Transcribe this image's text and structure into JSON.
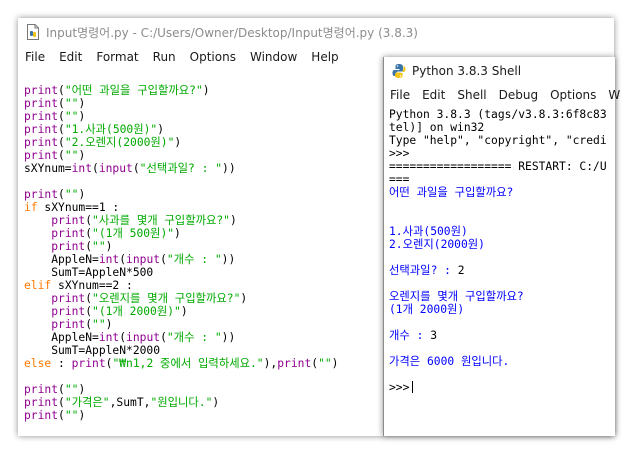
{
  "editor": {
    "title": "Input명령어.py - C:/Users/Owner/Desktop/Input명령어.py (3.8.3)",
    "menu": [
      "File",
      "Edit",
      "Format",
      "Run",
      "Options",
      "Window",
      "Help"
    ],
    "code": [
      [
        {
          "t": "print",
          "c": "bi"
        },
        {
          "t": "(",
          "c": "df"
        },
        {
          "t": "\"어떤 과일을 구입할까요?\"",
          "c": "st"
        },
        {
          "t": ")",
          "c": "df"
        }
      ],
      [
        {
          "t": "print",
          "c": "bi"
        },
        {
          "t": "(",
          "c": "df"
        },
        {
          "t": "\"\"",
          "c": "st"
        },
        {
          "t": ")",
          "c": "df"
        }
      ],
      [
        {
          "t": "print",
          "c": "bi"
        },
        {
          "t": "(",
          "c": "df"
        },
        {
          "t": "\"\"",
          "c": "st"
        },
        {
          "t": ")",
          "c": "df"
        }
      ],
      [
        {
          "t": "print",
          "c": "bi"
        },
        {
          "t": "(",
          "c": "df"
        },
        {
          "t": "\"1.사과(500원)\"",
          "c": "st"
        },
        {
          "t": ")",
          "c": "df"
        }
      ],
      [
        {
          "t": "print",
          "c": "bi"
        },
        {
          "t": "(",
          "c": "df"
        },
        {
          "t": "\"2.오렌지(2000원)\"",
          "c": "st"
        },
        {
          "t": ")",
          "c": "df"
        }
      ],
      [
        {
          "t": "print",
          "c": "bi"
        },
        {
          "t": "(",
          "c": "df"
        },
        {
          "t": "\"\"",
          "c": "st"
        },
        {
          "t": ")",
          "c": "df"
        }
      ],
      [
        {
          "t": "sXYnum=",
          "c": "df"
        },
        {
          "t": "int",
          "c": "bi"
        },
        {
          "t": "(",
          "c": "df"
        },
        {
          "t": "input",
          "c": "bi"
        },
        {
          "t": "(",
          "c": "df"
        },
        {
          "t": "\"선택과일? : \"",
          "c": "st"
        },
        {
          "t": "))",
          "c": "df"
        }
      ],
      [],
      [
        {
          "t": "print",
          "c": "bi"
        },
        {
          "t": "(",
          "c": "df"
        },
        {
          "t": "\"\"",
          "c": "st"
        },
        {
          "t": ")",
          "c": "df"
        }
      ],
      [
        {
          "t": "if",
          "c": "kw"
        },
        {
          "t": " sXYnum==1 :",
          "c": "df"
        }
      ],
      [
        {
          "t": "    ",
          "c": "df"
        },
        {
          "t": "print",
          "c": "bi"
        },
        {
          "t": "(",
          "c": "df"
        },
        {
          "t": "\"사과를 몇개 구입할까요?\"",
          "c": "st"
        },
        {
          "t": ")",
          "c": "df"
        }
      ],
      [
        {
          "t": "    ",
          "c": "df"
        },
        {
          "t": "print",
          "c": "bi"
        },
        {
          "t": "(",
          "c": "df"
        },
        {
          "t": "\"(1개 500원)\"",
          "c": "st"
        },
        {
          "t": ")",
          "c": "df"
        }
      ],
      [
        {
          "t": "    ",
          "c": "df"
        },
        {
          "t": "print",
          "c": "bi"
        },
        {
          "t": "(",
          "c": "df"
        },
        {
          "t": "\"\"",
          "c": "st"
        },
        {
          "t": ")",
          "c": "df"
        }
      ],
      [
        {
          "t": "    AppleN=",
          "c": "df"
        },
        {
          "t": "int",
          "c": "bi"
        },
        {
          "t": "(",
          "c": "df"
        },
        {
          "t": "input",
          "c": "bi"
        },
        {
          "t": "(",
          "c": "df"
        },
        {
          "t": "\"개수 : \"",
          "c": "st"
        },
        {
          "t": "))",
          "c": "df"
        }
      ],
      [
        {
          "t": "    SumT=AppleN*500",
          "c": "df"
        }
      ],
      [
        {
          "t": "elif",
          "c": "kw"
        },
        {
          "t": " sXYnum==2 :",
          "c": "df"
        }
      ],
      [
        {
          "t": "    ",
          "c": "df"
        },
        {
          "t": "print",
          "c": "bi"
        },
        {
          "t": "(",
          "c": "df"
        },
        {
          "t": "\"오렌지를 몇개 구입할까요?\"",
          "c": "st"
        },
        {
          "t": ")",
          "c": "df"
        }
      ],
      [
        {
          "t": "    ",
          "c": "df"
        },
        {
          "t": "print",
          "c": "bi"
        },
        {
          "t": "(",
          "c": "df"
        },
        {
          "t": "\"(1개 2000원)\"",
          "c": "st"
        },
        {
          "t": ")",
          "c": "df"
        }
      ],
      [
        {
          "t": "    ",
          "c": "df"
        },
        {
          "t": "print",
          "c": "bi"
        },
        {
          "t": "(",
          "c": "df"
        },
        {
          "t": "\"\"",
          "c": "st"
        },
        {
          "t": ")",
          "c": "df"
        }
      ],
      [
        {
          "t": "    AppleN=",
          "c": "df"
        },
        {
          "t": "int",
          "c": "bi"
        },
        {
          "t": "(",
          "c": "df"
        },
        {
          "t": "input",
          "c": "bi"
        },
        {
          "t": "(",
          "c": "df"
        },
        {
          "t": "\"개수 : \"",
          "c": "st"
        },
        {
          "t": "))",
          "c": "df"
        }
      ],
      [
        {
          "t": "    SumT=AppleN*2000",
          "c": "df"
        }
      ],
      [
        {
          "t": "else",
          "c": "kw"
        },
        {
          "t": " : ",
          "c": "df"
        },
        {
          "t": "print",
          "c": "bi"
        },
        {
          "t": "(",
          "c": "df"
        },
        {
          "t": "\"₩n1,2 중에서 입력하세요.\"",
          "c": "st"
        },
        {
          "t": "),",
          "c": "df"
        },
        {
          "t": "print",
          "c": "bi"
        },
        {
          "t": "(",
          "c": "df"
        },
        {
          "t": "\"\"",
          "c": "st"
        },
        {
          "t": ")",
          "c": "df"
        }
      ],
      [],
      [
        {
          "t": "print",
          "c": "bi"
        },
        {
          "t": "(",
          "c": "df"
        },
        {
          "t": "\"\"",
          "c": "st"
        },
        {
          "t": ")",
          "c": "df"
        }
      ],
      [
        {
          "t": "print",
          "c": "bi"
        },
        {
          "t": "(",
          "c": "df"
        },
        {
          "t": "\"가격은\"",
          "c": "st"
        },
        {
          "t": ",SumT,",
          "c": "df"
        },
        {
          "t": "\"원입니다.\"",
          "c": "st"
        },
        {
          "t": ")",
          "c": "df"
        }
      ],
      [
        {
          "t": "print",
          "c": "bi"
        },
        {
          "t": "(",
          "c": "df"
        },
        {
          "t": "\"\"",
          "c": "st"
        },
        {
          "t": ")",
          "c": "df"
        }
      ]
    ]
  },
  "shell": {
    "title": "Python 3.8.3 Shell",
    "menu": [
      "File",
      "Edit",
      "Shell",
      "Debug",
      "Options",
      "W"
    ],
    "output": [
      [
        {
          "t": "Python 3.8.3 (tags/v3.8.3:6f8c83",
          "c": "df"
        }
      ],
      [
        {
          "t": "tel)] on win32",
          "c": "df"
        }
      ],
      [
        {
          "t": "Type \"help\", \"copyright\", \"credi",
          "c": "df"
        }
      ],
      [
        {
          "t": ">>> ",
          "c": "df"
        }
      ],
      [
        {
          "t": "================== RESTART: C:/U",
          "c": "df"
        }
      ],
      [
        {
          "t": "===",
          "c": "df"
        }
      ],
      [
        {
          "t": "어떤 과일을 구입할까요?",
          "c": "so"
        }
      ],
      [],
      [],
      [
        {
          "t": "1.사과(500원)",
          "c": "so"
        }
      ],
      [
        {
          "t": "2.오렌지(2000원)",
          "c": "so"
        }
      ],
      [],
      [
        {
          "t": "선택과일? : ",
          "c": "so"
        },
        {
          "t": "2",
          "c": "df"
        }
      ],
      [],
      [
        {
          "t": "오렌지를 몇개 구입할까요?",
          "c": "so"
        }
      ],
      [
        {
          "t": "(1개 2000원)",
          "c": "so"
        }
      ],
      [],
      [
        {
          "t": "개수 : ",
          "c": "so"
        },
        {
          "t": "3",
          "c": "df"
        }
      ],
      [],
      [
        {
          "t": "가격은 6000 원입니다.",
          "c": "so"
        }
      ],
      [],
      [
        {
          "t": ">>>",
          "c": "df"
        }
      ]
    ]
  },
  "colors": {
    "keyword": "#ff7700",
    "builtin": "#900090",
    "string": "#00aa00",
    "stdout": "#0000ff",
    "default": "#000000"
  },
  "icons": {
    "editor_icon": "python-file-icon",
    "shell_icon": "python-logo-icon"
  }
}
